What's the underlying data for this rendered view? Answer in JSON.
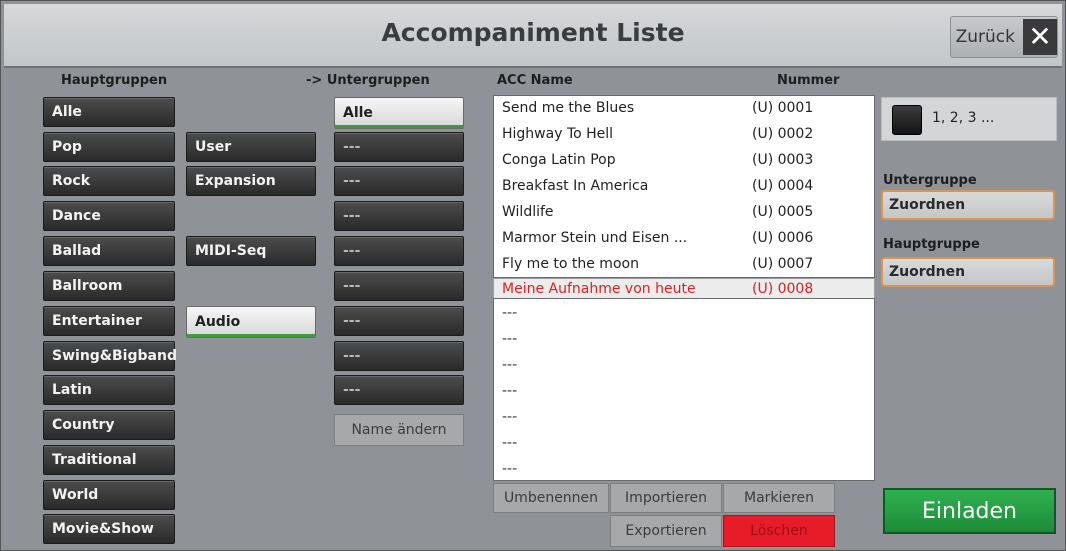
{
  "window": {
    "title": "Accompaniment Liste",
    "back_label": "Zurück",
    "close_glyph": "✕"
  },
  "headers": {
    "main_groups": "Hauptgruppen",
    "sub_groups": "-> Untergruppen",
    "acc_name": "ACC Name",
    "number": "Nummer"
  },
  "main_groups": [
    "Alle",
    "Pop",
    "Rock",
    "Dance",
    "Ballad",
    "Ballroom",
    "Entertainer",
    "Swing&Bigband",
    "Latin",
    "Country",
    "Traditional",
    "World",
    "Movie&Show"
  ],
  "source_buttons": {
    "user": "User",
    "expansion": "Expansion",
    "midi_seq": "MIDI-Seq",
    "audio": "Audio"
  },
  "sub_groups": [
    "Alle",
    "---",
    "---",
    "---",
    "---",
    "---",
    "---",
    "---",
    "---"
  ],
  "rename_subgroup": "Name ändern",
  "acc_list": [
    {
      "name": "Send me the Blues",
      "number": "(U) 0001"
    },
    {
      "name": "Highway To Hell",
      "number": "(U) 0002"
    },
    {
      "name": "Conga Latin Pop",
      "number": "(U) 0003"
    },
    {
      "name": "Breakfast In America",
      "number": "(U) 0004"
    },
    {
      "name": "Wildlife",
      "number": "(U) 0005"
    },
    {
      "name": "Marmor Stein und Eisen ...",
      "number": "(U) 0006"
    },
    {
      "name": "Fly me to the moon",
      "number": "(U) 0007"
    }
  ],
  "selected_row": {
    "name": "Meine Aufnahme von heute",
    "number": "(U) 0008"
  },
  "empty_rows": [
    "---",
    "---",
    "---",
    "---",
    "---",
    "---",
    "---"
  ],
  "list_actions": {
    "rename": "Umbenennen",
    "import": "Importieren",
    "mark": "Markieren",
    "export": "Exportieren",
    "delete": "Löschen"
  },
  "side": {
    "numbering_label": "1, 2, 3 ...",
    "subgroup_label": "Untergruppe",
    "subgroup_assign": "Zuordnen",
    "maingroup_label": "Hauptgruppe",
    "maingroup_assign": "Zuordnen",
    "load": "Einladen"
  },
  "colors": {
    "selected_text": "#e02020",
    "load_button": "#27a047",
    "delete_button": "#e81c28",
    "assign_border": "#e0944a"
  }
}
